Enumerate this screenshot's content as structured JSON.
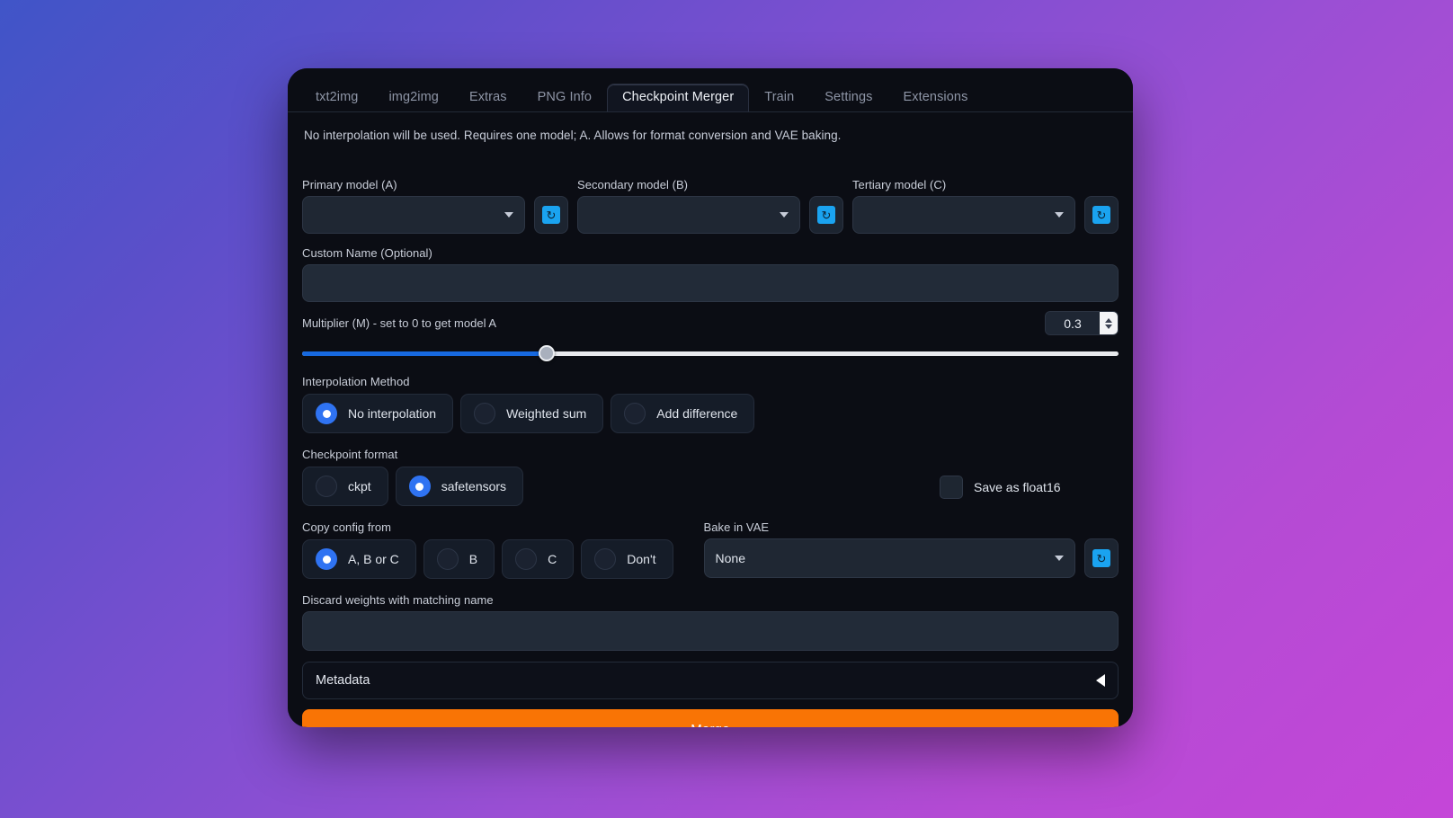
{
  "window": {
    "tabs": [
      {
        "label": "txt2img",
        "active": false
      },
      {
        "label": "img2img",
        "active": false
      },
      {
        "label": "Extras",
        "active": false
      },
      {
        "label": "PNG Info",
        "active": false
      },
      {
        "label": "Checkpoint Merger",
        "active": true
      },
      {
        "label": "Train",
        "active": false
      },
      {
        "label": "Settings",
        "active": false
      },
      {
        "label": "Extensions",
        "active": false
      }
    ]
  },
  "notice": "No interpolation will be used. Requires one model; A. Allows for format conversion and VAE baking.",
  "models": {
    "primary": {
      "label": "Primary model (A)",
      "value": "",
      "refresh_icon": "refresh-icon"
    },
    "secondary": {
      "label": "Secondary model (B)",
      "value": "",
      "refresh_icon": "refresh-icon"
    },
    "tertiary": {
      "label": "Tertiary model (C)",
      "value": "",
      "refresh_icon": "refresh-icon"
    }
  },
  "custom_name": {
    "label": "Custom Name (Optional)",
    "value": "",
    "placeholder": ""
  },
  "multiplier": {
    "label": "Multiplier (M) - set to 0 to get model A",
    "value": "0.3",
    "percent": 30,
    "min": 0,
    "max": 1
  },
  "interpolation": {
    "label": "Interpolation Method",
    "options": [
      {
        "label": "No interpolation",
        "selected": true
      },
      {
        "label": "Weighted sum",
        "selected": false
      },
      {
        "label": "Add difference",
        "selected": false
      }
    ]
  },
  "checkpoint_format": {
    "label": "Checkpoint format",
    "options": [
      {
        "label": "ckpt",
        "selected": false
      },
      {
        "label": "safetensors",
        "selected": true
      }
    ]
  },
  "save_float16": {
    "label": "Save as float16",
    "checked": false
  },
  "copy_config": {
    "label": "Copy config from",
    "options": [
      {
        "label": "A, B or C",
        "selected": true
      },
      {
        "label": "B",
        "selected": false
      },
      {
        "label": "C",
        "selected": false
      },
      {
        "label": "Don't",
        "selected": false
      }
    ]
  },
  "bake_vae": {
    "label": "Bake in VAE",
    "value": "None",
    "refresh_icon": "refresh-icon"
  },
  "discard_weights": {
    "label": "Discard weights with matching name",
    "value": "",
    "placeholder": ""
  },
  "metadata": {
    "label": "Metadata",
    "caret_icon": "caret-left-icon",
    "expanded": false
  },
  "merge_button": {
    "label": "Merge"
  },
  "colors": {
    "accent_blue": "#2f73f2",
    "refresh_cyan": "#1aa3f0",
    "merge_orange": "#f97405",
    "panel_bg": "#0b0d14",
    "input_bg": "#222b38"
  }
}
